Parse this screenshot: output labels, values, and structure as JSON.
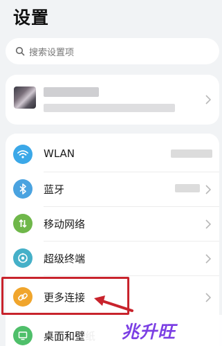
{
  "title": "设置",
  "search": {
    "placeholder": "搜索设置项"
  },
  "settings": [
    {
      "label": "WLAN",
      "icon": "wifi-icon",
      "color": "#3ba8e8"
    },
    {
      "label": "蓝牙",
      "icon": "bluetooth-icon",
      "color": "#4aa3e0"
    },
    {
      "label": "移动网络",
      "icon": "mobile-data-icon",
      "color": "#6fb74a"
    },
    {
      "label": "超级终端",
      "icon": "super-device-icon",
      "color": "#45b0c8"
    },
    {
      "label": "更多连接",
      "icon": "link-icon",
      "color": "#f0a52c"
    },
    {
      "label": "桌面和壁纸",
      "icon": "desktop-icon",
      "color": "#4fbf6a"
    }
  ],
  "watermark": {
    "text": "兆升旺"
  },
  "colors": {
    "highlight": "#c8232c",
    "watermark": "#7b3fe4"
  }
}
